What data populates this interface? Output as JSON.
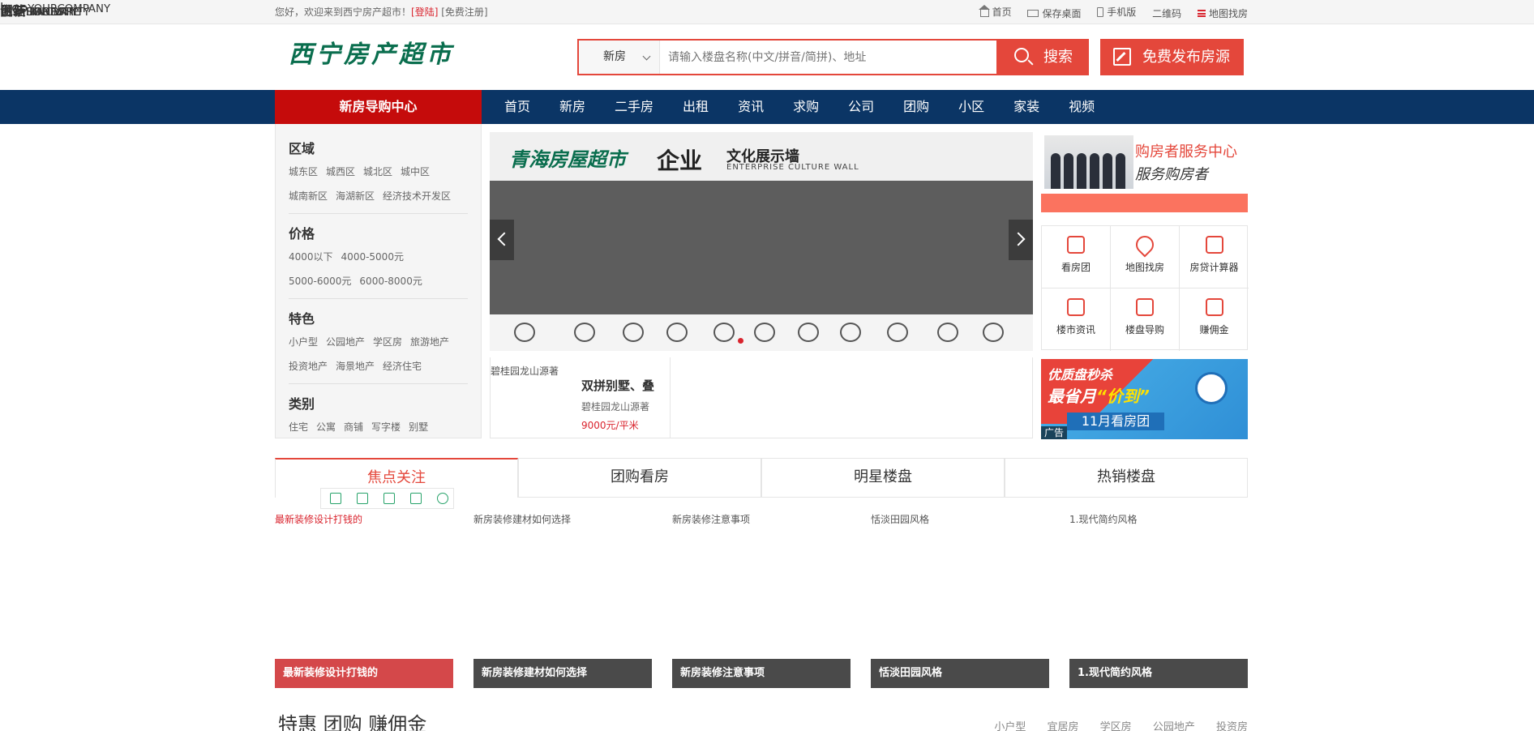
{
  "topbar": {
    "welcome": "您好，欢迎来到西宁房产超市！",
    "login": "[登陆]",
    "register": "[免费注册]",
    "links": [
      "首页",
      "保存桌面",
      "手机版",
      "二维码",
      "地图找房"
    ]
  },
  "header": {
    "logo_text": "西宁房产超市",
    "search_type": "新房",
    "search_placeholder": "请输入楼盘名称(中文/拼音/简拼)、地址",
    "search_label": "搜索",
    "publish_label": "免费发布房源"
  },
  "nav": {
    "guide": "新房导购中心",
    "items": [
      "首页",
      "新房",
      "二手房",
      "出租",
      "资讯",
      "求购",
      "公司",
      "团购",
      "小区",
      "家装",
      "视频"
    ]
  },
  "filters": [
    {
      "title": "区域",
      "options": [
        "城东区",
        "城西区",
        "城北区",
        "城中区",
        "城南新区",
        "海湖新区",
        "经济技术开发区"
      ]
    },
    {
      "title": "价格",
      "options": [
        "4000以下",
        "4000-5000元",
        "5000-6000元",
        "6000-8000元"
      ]
    },
    {
      "title": "特色",
      "options": [
        "小户型",
        "公园地产",
        "学区房",
        "旅游地产",
        "投资地产",
        "海景地产",
        "经济住宅"
      ]
    },
    {
      "title": "类别",
      "options": [
        "住宅",
        "公寓",
        "商铺",
        "写字楼",
        "别墅"
      ]
    }
  ],
  "banner": {
    "title": "青海房屋超市",
    "title_big": "企业",
    "title_right": "文化展示墙",
    "subtitle": "ENTERPRISE CULTURE WALL",
    "cards": [
      {
        "text": "logo",
        "sub": "YOURCOMPANY"
      },
      {
        "text": "诚信",
        "sub": "HONESTY"
      },
      {
        "text": "团结",
        "sub": "SOLIDARITY"
      },
      {
        "text": "创新",
        "sub": "INNOVATE"
      },
      {
        "text": "责任",
        "sub": "LIABILITY"
      }
    ]
  },
  "property": {
    "image_alt": "碧桂园龙山源著",
    "name": "双拼别墅、叠",
    "subname": "碧桂园龙山源著",
    "price": "9000元/平米"
  },
  "service": {
    "title": "购房者服务中心",
    "subtitle": "服务购房者",
    "grid": [
      "看房团",
      "地图找房",
      "房贷计算器",
      "楼市资讯",
      "楼盘导购",
      "赚佣金"
    ]
  },
  "ad": {
    "line1": "优质盘秒杀",
    "line2_prefix": "最省月",
    "line2_highlight": "“价到”",
    "line3": "11月看房团",
    "tag": "广告"
  },
  "tabs": [
    "焦点关注",
    "团购看房",
    "明星楼盘",
    "热销楼盘"
  ],
  "decor": [
    {
      "alt": "最新装修设计打钱的",
      "caption": "最新装修设计打钱的"
    },
    {
      "alt": "新房装修建材如何选择",
      "caption": "新房装修建材如何选择"
    },
    {
      "alt": "新房装修注意事项",
      "caption": "新房装修注意事项"
    },
    {
      "alt": "恬淡田园风格",
      "caption": "恬淡田园风格"
    },
    {
      "alt": "1.现代简约风格",
      "caption": "1.现代简约风格"
    }
  ],
  "section": {
    "title": "特惠 团购 赚佣金",
    "tags": [
      "小户型",
      "宜居房",
      "学区房",
      "公园地产",
      "投资房"
    ]
  }
}
